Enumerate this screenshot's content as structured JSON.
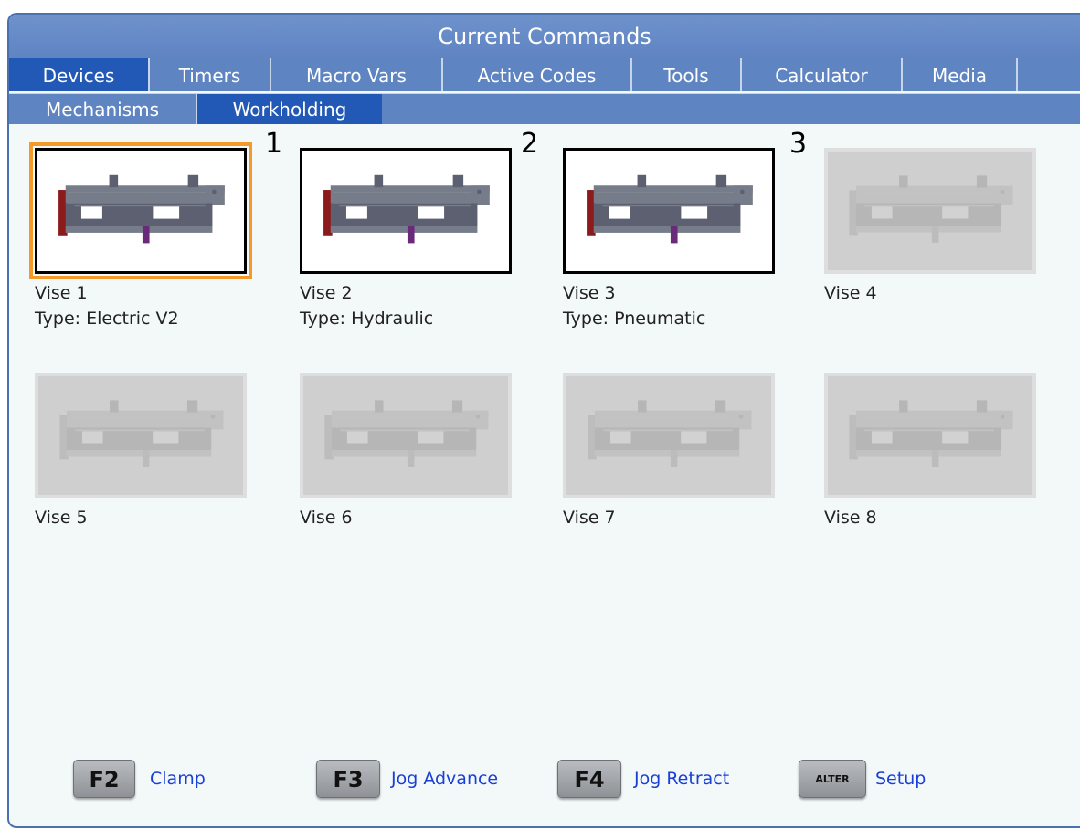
{
  "window": {
    "title": "Current Commands"
  },
  "tabs": [
    "Devices",
    "Timers",
    "Macro Vars",
    "Active Codes",
    "Tools",
    "Calculator",
    "Media"
  ],
  "active_tab": "Devices",
  "subtabs": [
    "Mechanisms",
    "Workholding"
  ],
  "active_subtab": "Workholding",
  "vises": [
    {
      "name": "Vise 1",
      "type": "Type: Electric V2",
      "enabled": true,
      "selected": true
    },
    {
      "name": "Vise 2",
      "type": "Type: Hydraulic",
      "enabled": true,
      "selected": false
    },
    {
      "name": "Vise 3",
      "type": "Type: Pneumatic",
      "enabled": true,
      "selected": false
    },
    {
      "name": "Vise 4",
      "type": "",
      "enabled": false,
      "selected": false
    },
    {
      "name": "Vise 5",
      "type": "",
      "enabled": false,
      "selected": false
    },
    {
      "name": "Vise 6",
      "type": "",
      "enabled": false,
      "selected": false
    },
    {
      "name": "Vise 7",
      "type": "",
      "enabled": false,
      "selected": false
    },
    {
      "name": "Vise 8",
      "type": "",
      "enabled": false,
      "selected": false
    }
  ],
  "callouts": [
    "1",
    "2",
    "3"
  ],
  "function_keys": [
    {
      "key": "F2",
      "label": "Clamp"
    },
    {
      "key": "F3",
      "label": "Jog Advance"
    },
    {
      "key": "F4",
      "label": "Jog Retract"
    },
    {
      "key": "ALTER",
      "label": "Setup"
    }
  ],
  "colors": {
    "title_bar": "#5f84c2",
    "active_tab": "#2258b6",
    "selection_ring": "#f39a2b",
    "key_label": "#1a3fd6",
    "panel_bg": "#f3f8f8"
  }
}
